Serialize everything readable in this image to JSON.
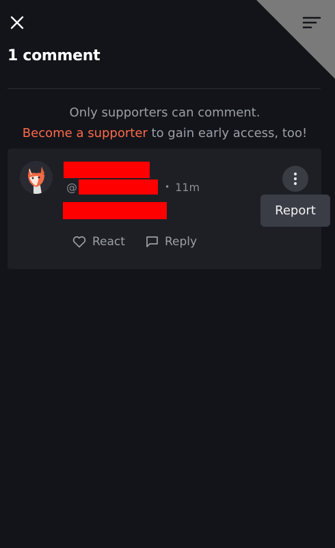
{
  "header": {
    "close_icon": "close-icon",
    "sort_icon": "sort-lines-icon",
    "title": "1 comment"
  },
  "notice": {
    "line1": "Only supporters can comment.",
    "link": "Become a supporter",
    "line2_rest": " to gain early access, too!"
  },
  "comment": {
    "handle_prefix": "@",
    "separator": "•",
    "time": "11m",
    "react_label": "React",
    "reply_label": "Reply",
    "more_icon": "more-vertical-icon"
  },
  "menu": {
    "report_label": "Report"
  },
  "colors": {
    "background": "#131419",
    "card": "#1e1f24",
    "accent_link": "#ff6a4c",
    "redaction": "#ff0000"
  }
}
